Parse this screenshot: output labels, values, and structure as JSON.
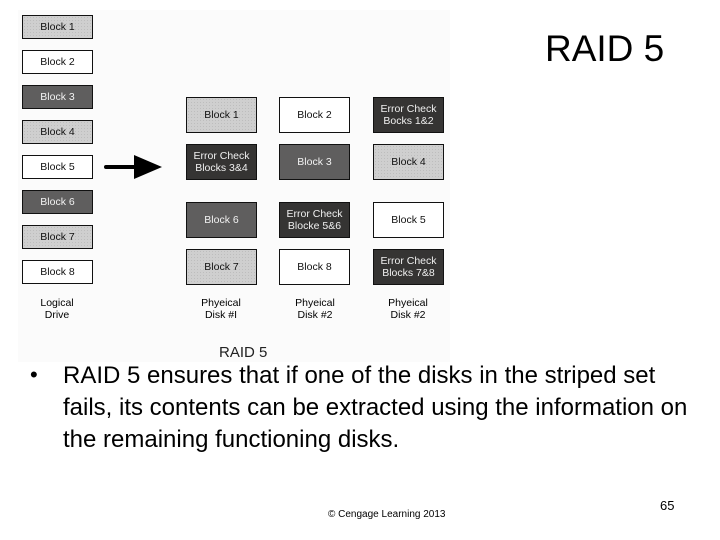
{
  "slide": {
    "title": "RAID 5",
    "bullet": "RAID 5 ensures that if one of the disks in the striped set fails, its contents can be extracted using the information on the remaining functioning disks.",
    "footer": "© Cengage Learning  2013",
    "page_number": "65"
  },
  "figure": {
    "caption": "RAID 5",
    "arrow_icon": "right-arrow",
    "colors": {
      "white": "#ffffff",
      "light": "#cfcfcf",
      "mid": "#5f5e5e",
      "dark": "#353433"
    },
    "logical_drive": {
      "label": "Logical\nDrive",
      "blocks": [
        {
          "label": "Block 1",
          "shade": "light"
        },
        {
          "label": "Block 2",
          "shade": "white"
        },
        {
          "label": "Block 3",
          "shade": "mid"
        },
        {
          "label": "Block 4",
          "shade": "light"
        },
        {
          "label": "Block 5",
          "shade": "white"
        },
        {
          "label": "Block 6",
          "shade": "mid"
        },
        {
          "label": "Block 7",
          "shade": "light"
        },
        {
          "label": "Block 8",
          "shade": "white"
        }
      ]
    },
    "disks": [
      {
        "label": "Phyeical\nDisk #I",
        "blocks": [
          {
            "label": "Block 1",
            "shade": "light"
          },
          {
            "label": "Error Check\nBlocks 3&4",
            "shade": "dark"
          },
          {
            "label": "Block 6",
            "shade": "mid"
          },
          {
            "label": "Block 7",
            "shade": "light"
          }
        ]
      },
      {
        "label": "Phyeical\nDisk #2",
        "blocks": [
          {
            "label": "Block 2",
            "shade": "white"
          },
          {
            "label": "Block 3",
            "shade": "mid"
          },
          {
            "label": "Error Check\nBlocke 5&6",
            "shade": "dark"
          },
          {
            "label": "Block 8",
            "shade": "white"
          }
        ]
      },
      {
        "label": "Phyeical\nDisk #2",
        "blocks": [
          {
            "label": "Error Check\nBocks 1&2",
            "shade": "dark"
          },
          {
            "label": "Block 4",
            "shade": "light"
          },
          {
            "label": "Block 5",
            "shade": "white"
          },
          {
            "label": "Error Check\nBlocks 7&8",
            "shade": "dark"
          }
        ]
      }
    ]
  }
}
